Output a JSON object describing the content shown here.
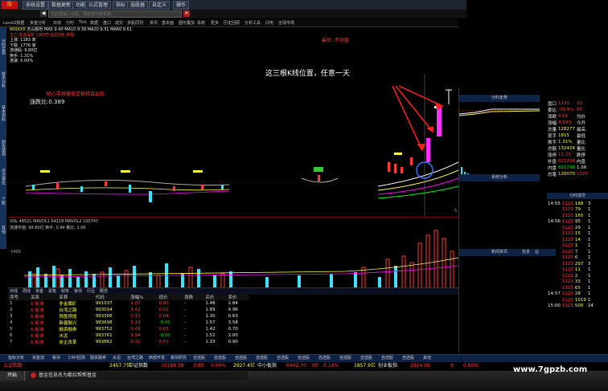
{
  "toolbar": {
    "buttons": [
      "系统设置",
      "数据更新",
      "功能",
      "公式管理",
      "指标",
      "选股器",
      "自定义",
      "操作"
    ],
    "search_placeholder": "在此框输入代码、简拼或功能名称"
  },
  "menubar": {
    "items": [
      "Level2数据",
      "资金分析",
      "日线",
      "分时",
      "Tick",
      "数据",
      "盘口",
      "成交",
      "多股同列",
      "资讯",
      "基本面",
      "图形叠加",
      "系统",
      "更多",
      "历史回顾",
      "分析工具",
      "闪电",
      "全球市场"
    ]
  },
  "header": {
    "stock_code": "600XXX",
    "stock_name": "天山股份",
    "line1": "MA5 9.40 MA10 9.39 MA20 9.31 MA60 9.61",
    "line2": "主力 非金属矿 CRH司 延迟3天 新股",
    "line3": "上涨: 1183 家",
    "line4": "下跌: 1776 家",
    "line5": "流通股: 9.80亿",
    "line6": "换手: 1.31%",
    "line7": "涨速: 0.00%",
    "indicator_text": "涨跌比:0.389",
    "red_notice": "最后: 不动盘",
    "chart_title": "聪心零钟量低交易机会出现"
  },
  "annotation": {
    "text": "这三根K线位置，任意一天"
  },
  "volume_panel": {
    "label": "VOL",
    "values": "VOL 48521 MAVOL1 54118 MAVOL2 100747",
    "sub": "流通市值: 98.60亿 换手: 0.94 量比: 1.06",
    "tick_y": "7400"
  },
  "panel_tabs": [
    "日线",
    "周线",
    "资金",
    "逐笔",
    "财务",
    "板块",
    "行业",
    "概念"
  ],
  "grid": {
    "headers": [
      "序号",
      "关系",
      "名称",
      "代码",
      "涨幅%",
      "现价",
      "涨跌",
      "买价",
      "卖价",
      "总量",
      "现量",
      "换手率%"
    ],
    "rows": [
      {
        "idx": "1",
        "rel": "5 板块",
        "name": "非金属矿",
        "code": "991037",
        "chg": "2.07",
        "v1": "0.80",
        "v2": "-",
        "v3": "1.48",
        "v4": "2.84"
      },
      {
        "idx": "2",
        "rel": "5 板块",
        "name": "台湾之路",
        "code": "993034",
        "chg": "3.42",
        "v1": "0.02",
        "v2": "-",
        "v3": "1.89",
        "v4": "4.96"
      },
      {
        "idx": "3",
        "rel": "5 板块",
        "name": "预盈预增",
        "code": "993306",
        "chg": "0.15",
        "v1": "0.04",
        "v2": "-",
        "v3": "1.30",
        "v4": "0.63"
      },
      {
        "idx": "4",
        "rel": "5 板块",
        "name": "新疆振兴",
        "code": "993698",
        "chg": "3.14",
        "v1": "-0.00",
        "v2": "-",
        "v3": "1.57",
        "v4": "3.58"
      },
      {
        "idx": "5",
        "rel": "5 板块",
        "name": "融资融券",
        "code": "993752",
        "chg": "0.49",
        "v1": "0.03",
        "v2": "-",
        "v3": "1.42",
        "v4": "0.70"
      },
      {
        "idx": "6",
        "rel": "5 板块",
        "name": "水泥",
        "code": "993761",
        "chg": "3.94",
        "v1": "-0.00",
        "v2": "-",
        "v3": "1.52",
        "v4": "2.00"
      },
      {
        "idx": "7",
        "rel": "5 板块",
        "name": "央企改革",
        "code": "993862",
        "chg": "0.31",
        "v1": "0.01",
        "v2": "-",
        "v3": "1.33",
        "v4": "0.90"
      }
    ]
  },
  "bottom_tabs": [
    "指标分析",
    "资金流",
    "板块",
    "CRH回测",
    "融资融券",
    "水泥",
    "台湾之路",
    "西部开发",
    "板块研究",
    "自选股",
    "自选股",
    "自选股",
    "自选股",
    "自选股",
    "自选股",
    "自选股",
    "自选股",
    "自选股",
    "自选股",
    "自选股",
    "其他"
  ],
  "status_bar": {
    "index1_name": "上证指数",
    "index1_val": "2457.7亿",
    "index2_name": "中证指数",
    "index2_val": "10186.38",
    "index2_chg": "3.65",
    "index2_pct": "0.04%",
    "index3_name": "中小板指",
    "index3_amt": "2927.4亿",
    "index3_val": "6442.70",
    "index3_chg": "95",
    "index3_pct": "0.14%",
    "index4_amt": "1857.9亿",
    "index4_name": "创业板指",
    "index4_val": "2524.56",
    "index4_chg": "9",
    "index4_pct": "0.60%"
  },
  "taskbar": {
    "text": "基金信息名为都拉帮帮基金",
    "start": "开始"
  },
  "right_panel": {
    "title": "分时走势",
    "system_label": "系统分析",
    "quotes": [
      {
        "k": "盘口",
        "v": "1123",
        "v2": "23"
      },
      {
        "k": "委比",
        "v": "-39.9%",
        "v2": "65"
      },
      {
        "k": "涨跌",
        "v": "0.01",
        "v2": "均价"
      },
      {
        "k": "涨幅",
        "v": "9.99%",
        "v2": "今开"
      },
      {
        "k": "总量",
        "v": "128277",
        "v2": "最高"
      },
      {
        "k": "现手",
        "v": "1815",
        "v2": "最低"
      },
      {
        "k": "换手",
        "v": "1.31%",
        "v2": "量比"
      },
      {
        "k": "总额",
        "v": "132424",
        "v2": "量比"
      },
      {
        "k": "涨停",
        "v": "11.23",
        "v2": "跌停"
      },
      {
        "k": "外盘",
        "v": "621204",
        "v2": "内盘"
      },
      {
        "k": "内盘",
        "v": "621298",
        "v2": "1.06"
      },
      {
        "k": "总笔",
        "v": "126070",
        "v2": "1123"
      }
    ],
    "quote_right_vals": [
      "11.23",
      "13.67",
      "今开",
      "10.23",
      "最高",
      "3.61",
      "量比",
      "1.06",
      "跌停",
      "9.12",
      "1.01"
    ],
    "ticks_title": "分时成交",
    "ticks": [
      {
        "t": "14:55",
        "p": "1123",
        "v": "188",
        "d": "3"
      },
      {
        "t": "",
        "p": "1123",
        "v": "79",
        "d": "1"
      },
      {
        "t": "",
        "p": "1123",
        "v": "165",
        "d": "1"
      },
      {
        "t": "14:56",
        "p": "1123",
        "v": "95",
        "d": "1"
      },
      {
        "t": "",
        "p": "1123",
        "v": "29",
        "d": "1"
      },
      {
        "t": "",
        "p": "1123",
        "v": "15",
        "d": "1"
      },
      {
        "t": "",
        "p": "1123",
        "v": "14",
        "d": "1"
      },
      {
        "t": "",
        "p": "1123",
        "v": "1",
        "d": "1"
      },
      {
        "t": "",
        "p": "1123",
        "v": "7",
        "d": "1"
      },
      {
        "t": "",
        "p": "1123",
        "v": "6",
        "d": "1"
      },
      {
        "t": "",
        "p": "1123",
        "v": "297",
        "d": "3"
      },
      {
        "t": "",
        "p": "1123",
        "v": "11",
        "d": "1"
      },
      {
        "t": "",
        "p": "1123",
        "v": "2",
        "d": "1"
      },
      {
        "t": "",
        "p": "1123",
        "v": "33",
        "d": "1"
      },
      {
        "t": "",
        "p": "1123",
        "v": "65",
        "d": "1"
      },
      {
        "t": "14:57",
        "p": "1123",
        "v": "28",
        "d": "1"
      },
      {
        "t": "",
        "p": "1123",
        "v": "1019",
        "d": "1"
      },
      {
        "t": "15:00",
        "p": "1123",
        "v": "500",
        "d": "24"
      }
    ],
    "news_title": "新闻资讯",
    "news_tabs": [
      "信息",
      "业"
    ]
  },
  "watermark": "www.7gpzb.com"
}
